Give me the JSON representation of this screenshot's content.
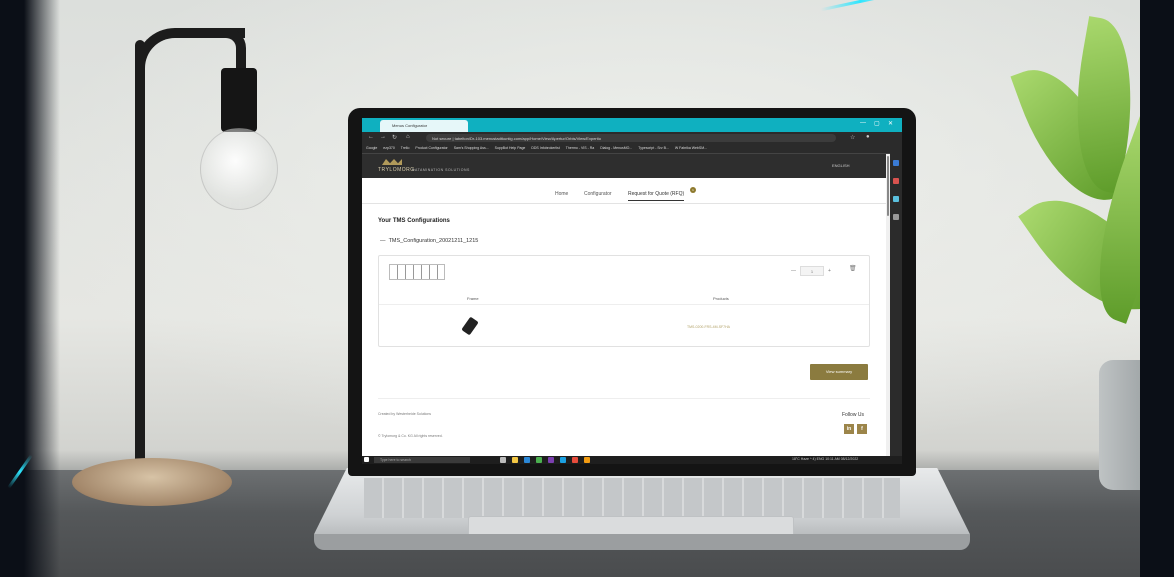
{
  "browser": {
    "tab_title": "Menus Configurator",
    "url": "Not secure | tabelton/Dr-103.menustadtkuntig.com/app/Home/View/Apertur/Orbis/View/Expertio",
    "bookmarks": [
      "Google",
      "ezp370",
      "Trello",
      "Product Configurator",
      "Sam's Shopping Ass...",
      "SuppBot Help Page",
      "DDS Infobrokerlist",
      "Thermo - VIS - Ra",
      "Dialog - MenusMO...",
      "Typescript - Srv B...",
      "W Fabrika WebSM..."
    ],
    "window_controls": [
      "—",
      "▢",
      "✕"
    ]
  },
  "site": {
    "logo": "TRYLOMORG",
    "logo_sub": "DATAMINATION SOLUTIONS",
    "language": "ENGLISH",
    "nav": [
      "Home",
      "Configurator",
      "Request for Quote (RFQ)"
    ],
    "rfq_count": "1"
  },
  "content": {
    "heading": "Your TMS Configurations",
    "config_name": "TMS_Configuration_20021211_1215",
    "quantity": "1",
    "col_frame": "Frame",
    "col_products": "Products",
    "product_code": "TMS-0200-FRS-4M-SF7HA",
    "summary_button": "View summary"
  },
  "footer": {
    "line1": "Created by Westerheide Solutions",
    "line2": "© Trylomorg & Co. KG All rights reserved.",
    "follow": "Follow Us",
    "social": [
      "in",
      "f"
    ]
  },
  "taskbar": {
    "search_placeholder": "Type here to search",
    "tray": "18°C Haze  ^ 4) ENG  10:11 AM 08/12/2022"
  }
}
